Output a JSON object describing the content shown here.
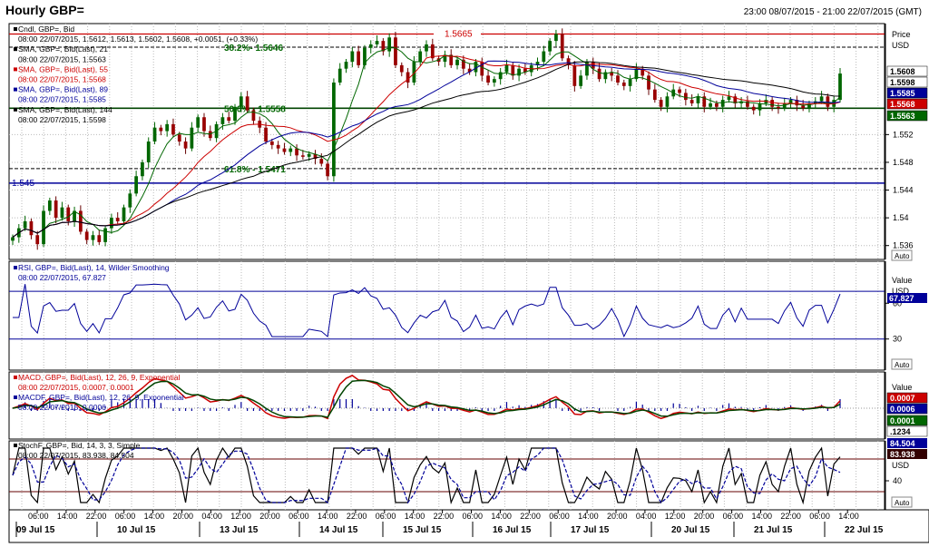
{
  "window": {
    "title": "Hourly GBP=",
    "date_range": "23:00 08/07/2015 - 21:00 22/07/2015 (GMT)"
  },
  "price_panel": {
    "legend": [
      {
        "text": "Cndl, GBP=, Bid",
        "color": "#000000"
      },
      {
        "text": "08:00 22/07/2015, 1.5612, 1.5613, 1.5602, 1.5608, +0.0051, (+0.33%)",
        "color": "#000000"
      },
      {
        "text": "SMA, GBP=, Bid(Last), 21",
        "color": "#000000"
      },
      {
        "text": "08:00 22/07/2015, 1.5563",
        "color": "#000000"
      },
      {
        "text": "SMA, GBP=, Bid(Last), 55",
        "color": "#cc0000"
      },
      {
        "text": "08:00 22/07/2015, 1.5568",
        "color": "#cc0000"
      },
      {
        "text": "SMA, GBP=, Bid(Last), 89",
        "color": "#000099"
      },
      {
        "text": "08:00 22/07/2015, 1.5585",
        "color": "#000099"
      },
      {
        "text": "SMA, GBP=, Bid(Last), 144",
        "color": "#000000"
      },
      {
        "text": "08:00 22/07/2015, 1.5598",
        "color": "#000000"
      }
    ],
    "axis_title": [
      "Price",
      "USD"
    ],
    "ticks": [
      "1.552",
      "1.548",
      "1.544",
      "1.54",
      "1.536"
    ],
    "levels": [
      {
        "label": "1.5665",
        "value": 1.5665,
        "color": "#cc0000"
      },
      {
        "label": "38.2%- 1.5646",
        "value": 1.5646,
        "color": "#006600"
      },
      {
        "label": "50.0% - 1.5558",
        "value": 1.5558,
        "color": "#006600"
      },
      {
        "label": "61.8% - 1.5471",
        "value": 1.5471,
        "color": "#006600"
      },
      {
        "label": "1.545",
        "value": 1.545,
        "color": "#000099"
      }
    ],
    "price_tags": [
      {
        "label": "1.5608",
        "bg": "#ffffff",
        "fg": "#000000"
      },
      {
        "label": "1.5598",
        "bg": "#ffffff",
        "fg": "#000000"
      },
      {
        "label": "1.5585",
        "bg": "#000099",
        "fg": "#ffffff"
      },
      {
        "label": "1.5568",
        "bg": "#cc0000",
        "fg": "#ffffff"
      },
      {
        "label": "1.5563",
        "bg": "#006600",
        "fg": "#ffffff"
      }
    ],
    "auto_label": "Auto"
  },
  "rsi_panel": {
    "legend": [
      {
        "text": "RSI, GBP=, Bid(Last), 14, Wilder Smoothing",
        "color": "#000099"
      },
      {
        "text": "08:00 22/07/2015, 67.827",
        "color": "#000099"
      }
    ],
    "axis_title": [
      "Value",
      "USD"
    ],
    "ticks": [
      "60",
      "30"
    ],
    "tag": "67.827",
    "auto_label": "Auto"
  },
  "macd_panel": {
    "legend": [
      {
        "text": "MACD, GBP=, Bid(Last), 12, 26, 9, Exponential",
        "color": "#cc0000"
      },
      {
        "text": "08:00 22/07/2015, 0.0007, 0.0001",
        "color": "#cc0000"
      },
      {
        "text": "MACDF, GBP=, Bid(Last), 12, 26, 9, Exponential",
        "color": "#000099"
      },
      {
        "text": "08:00 22/07/2015, 0.0006",
        "color": "#000099"
      }
    ],
    "axis_title": [
      "Value"
    ],
    "tags": [
      {
        "label": "0.0007",
        "bg": "#cc0000",
        "fg": "#ffffff"
      },
      {
        "label": "0.0006",
        "bg": "#000099",
        "fg": "#ffffff"
      },
      {
        "label": "0.0001",
        "bg": "#006600",
        "fg": "#ffffff"
      },
      {
        "label": ".1234",
        "bg": "#ffffff",
        "fg": "#000000"
      }
    ]
  },
  "stoch_panel": {
    "legend": [
      {
        "text": "StochF, GBP=, Bid, 14, 3, 3, Simple",
        "color": "#000000"
      },
      {
        "text": "08:00 22/07/2015, 83.938, 84.504",
        "color": "#000000"
      }
    ],
    "axis_title": [
      "USD"
    ],
    "ticks": [
      "40"
    ],
    "tags": [
      {
        "label": "84.504",
        "bg": "#000099",
        "fg": "#ffffff"
      },
      {
        "label": "83.938",
        "bg": "#330000",
        "fg": "#ffffff"
      }
    ],
    "auto_label": "Auto"
  },
  "time_axis": {
    "hours": [
      "06:00",
      "14:00",
      "22:00",
      "06:00",
      "14:00",
      "20:00",
      "04:00",
      "12:00",
      "20:00",
      "06:00",
      "14:00",
      "22:00",
      "06:00",
      "14:00",
      "22:00",
      "06:00",
      "14:00",
      "22:00",
      "06:00",
      "14:00",
      "20:00",
      "04:00",
      "12:00",
      "20:00",
      "06:00",
      "14:00",
      "22:00",
      "06:00",
      "14:00"
    ],
    "days": [
      "09 Jul 15",
      "10 Jul 15",
      "13 Jul 15",
      "14 Jul 15",
      "15 Jul 15",
      "16 Jul 15",
      "17 Jul 15",
      "20 Jul 15",
      "21 Jul 15",
      "22 Jul 15"
    ]
  },
  "chart_data": {
    "type": "candlestick",
    "title": "Hourly GBP=",
    "ylim": [
      1.534,
      1.568
    ],
    "close_series": [
      1.5372,
      1.5385,
      1.5395,
      1.5375,
      1.5362,
      1.541,
      1.5425,
      1.54,
      1.5415,
      1.5395,
      1.541,
      1.538,
      1.5368,
      1.5375,
      1.5365,
      1.5385,
      1.54,
      1.5395,
      1.5415,
      1.5435,
      1.546,
      1.548,
      1.551,
      1.553,
      1.5525,
      1.5535,
      1.552,
      1.551,
      1.55,
      1.553,
      1.5545,
      1.5525,
      1.5515,
      1.5535,
      1.5545,
      1.554,
      1.556,
      1.5575,
      1.5555,
      1.554,
      1.553,
      1.551,
      1.5505,
      1.55,
      1.5495,
      1.55,
      1.549,
      1.5488,
      1.5492,
      1.5485,
      1.5478,
      1.546,
      1.5595,
      1.5615,
      1.5625,
      1.564,
      1.562,
      1.5645,
      1.565,
      1.5655,
      1.564,
      1.566,
      1.562,
      1.561,
      1.5595,
      1.5625,
      1.564,
      1.565,
      1.563,
      1.5625,
      1.5635,
      1.562,
      1.5628,
      1.5615,
      1.561,
      1.5625,
      1.5605,
      1.5595,
      1.56,
      1.561,
      1.562,
      1.5605,
      1.5615,
      1.561,
      1.562,
      1.5625,
      1.564,
      1.5655,
      1.5665,
      1.563,
      1.562,
      1.559,
      1.5605,
      1.5625,
      1.5615,
      1.56,
      1.561,
      1.5605,
      1.5595,
      1.559,
      1.56,
      1.5615,
      1.5605,
      1.5585,
      1.557,
      1.556,
      1.5575,
      1.5585,
      1.558,
      1.557,
      1.5565,
      1.5575,
      1.556,
      1.5565,
      1.556,
      1.557,
      1.5575,
      1.5565,
      1.5568,
      1.556,
      1.5555,
      1.5565,
      1.557,
      1.556,
      1.5558,
      1.5565,
      1.557,
      1.5562,
      1.5558,
      1.5565,
      1.5568,
      1.5575,
      1.556,
      1.557,
      1.5608
    ],
    "levels": [
      1.5665,
      1.5646,
      1.5558,
      1.5471,
      1.545
    ]
  }
}
